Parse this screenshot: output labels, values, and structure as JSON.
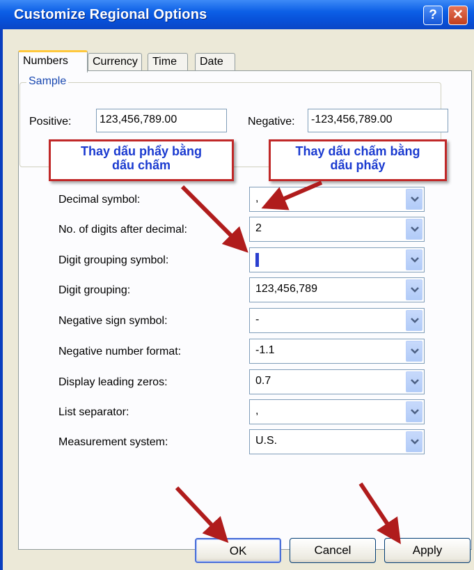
{
  "window": {
    "title": "Customize Regional Options",
    "help_label": "?",
    "close_label": "✕"
  },
  "tabs": [
    "Numbers",
    "Currency",
    "Time",
    "Date"
  ],
  "sample": {
    "legend": "Sample",
    "positive_label": "Positive:",
    "positive_value": "123,456,789.00",
    "negative_label": "Negative:",
    "negative_value": "-123,456,789.00"
  },
  "annotations": {
    "left_line1": "Thay dấu phẩy bằng",
    "left_line2": "dấu chấm",
    "right_line1": "Thay dấu chấm bằng",
    "right_line2": "dấu phẩy"
  },
  "settings": [
    {
      "label": "Decimal symbol:",
      "value": ","
    },
    {
      "label": "No. of digits after decimal:",
      "value": "2"
    },
    {
      "label": "Digit grouping symbol:",
      "value": ""
    },
    {
      "label": "Digit grouping:",
      "value": "123,456,789"
    },
    {
      "label": "Negative sign symbol:",
      "value": "-"
    },
    {
      "label": "Negative number format:",
      "value": "-1.1"
    },
    {
      "label": "Display leading zeros:",
      "value": "0.7"
    },
    {
      "label": "List separator:",
      "value": ","
    },
    {
      "label": "Measurement system:",
      "value": "U.S."
    }
  ],
  "buttons": {
    "ok": "OK",
    "cancel": "Cancel",
    "apply": "Apply"
  },
  "colors": {
    "titlebar": "#0c5fe6",
    "annotation_border": "#c02828",
    "annotation_text": "#1a3ad0",
    "arrow": "#b01c1c"
  }
}
